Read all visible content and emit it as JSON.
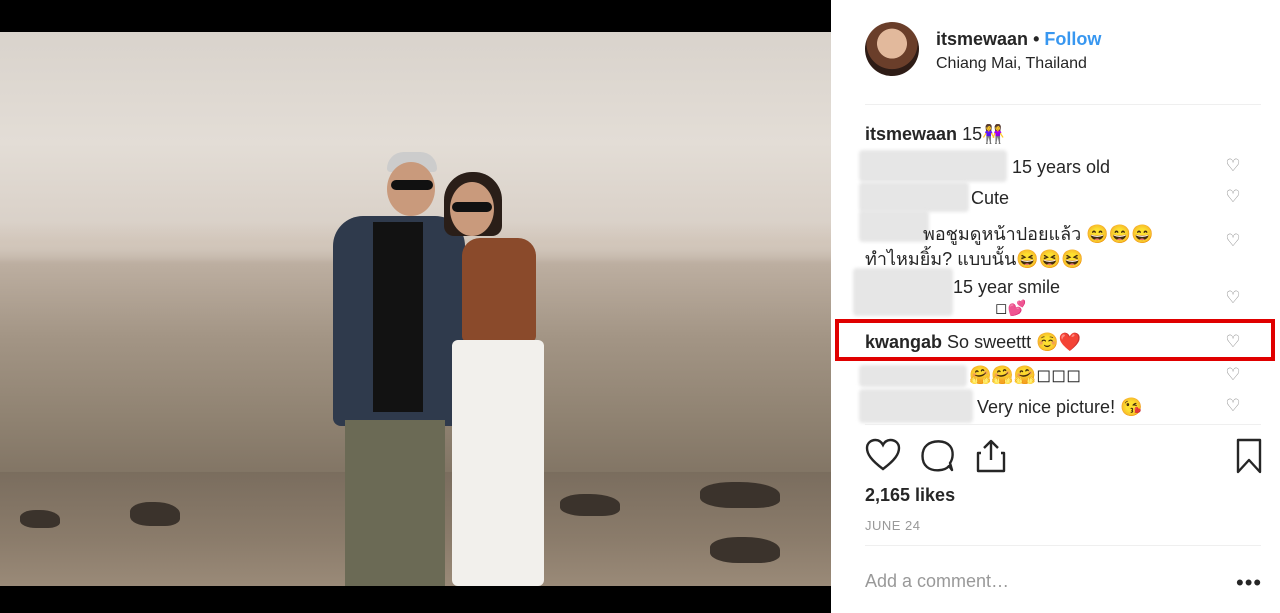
{
  "post": {
    "username": "itsmewaan",
    "follow_label": "Follow",
    "separator": "•",
    "location": "Chiang Mai, Thailand",
    "caption_user": "itsmewaan",
    "caption_text": "15👭"
  },
  "comments": [
    {
      "text": "15 years old"
    },
    {
      "text": "Cute"
    },
    {
      "text": "พอชูมดูหน้าปอยแล้ว 😄😄😄"
    },
    {
      "text": "ทำไหมยิ้ม? แบบนั้น😆😆😆"
    },
    {
      "text": "15 year smile"
    },
    {
      "text": "◻💕"
    },
    {
      "user": "kwangab",
      "text": "So sweettt ☺️❤️"
    },
    {
      "text": "🤗🤗🤗◻◻◻"
    },
    {
      "text": "Very nice picture! 😘"
    }
  ],
  "likes": "2,165 likes",
  "date": "JUNE 24",
  "add_comment_placeholder": "Add a comment…",
  "more_label": "•••",
  "colors": {
    "follow": "#3897f0",
    "highlight_border": "#e00000",
    "text": "#262626",
    "muted": "#999999"
  },
  "icons": [
    "heart-icon",
    "comment-icon",
    "share-icon",
    "bookmark-icon",
    "more-options-icon",
    "small-heart-icon"
  ]
}
